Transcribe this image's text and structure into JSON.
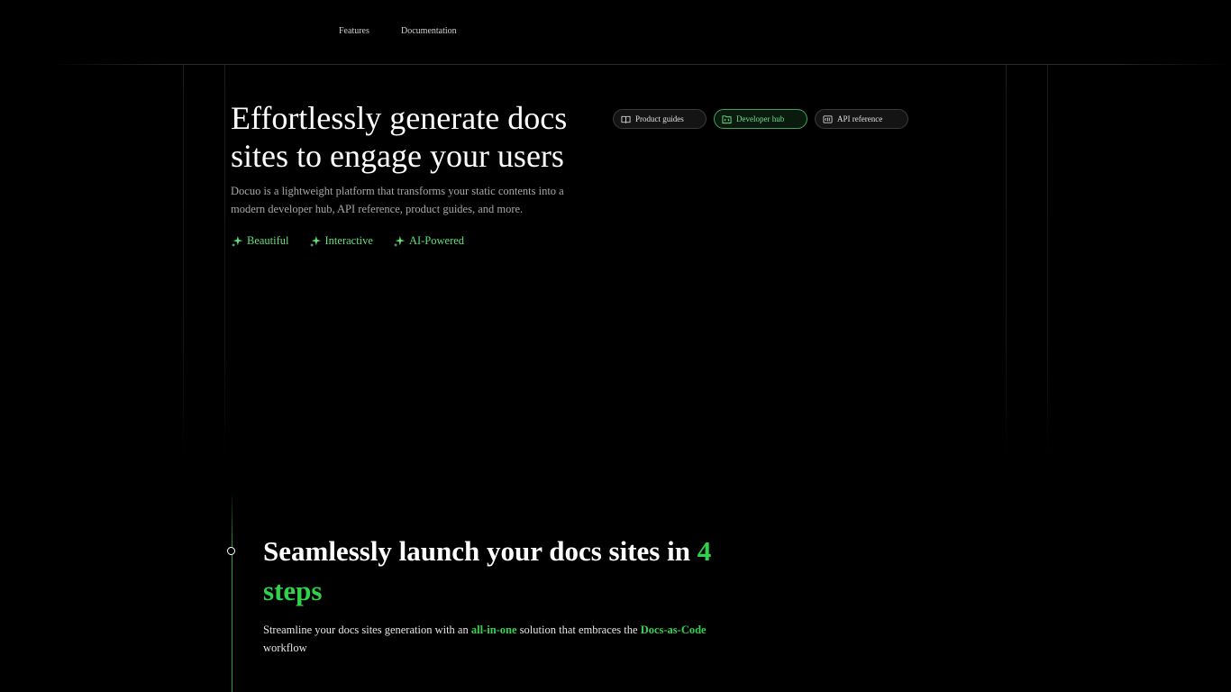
{
  "nav": {
    "links": [
      "Features",
      "Documentation"
    ]
  },
  "hero": {
    "title": "Effortlessly generate docs sites to engage your users",
    "subtitle": "Docuo is a lightweight platform that transforms your static contents into a modern developer hub, API reference, product guides, and more.",
    "features": [
      {
        "label": "Beautiful",
        "icon": "sparkle-icon"
      },
      {
        "label": "Interactive",
        "icon": "sparkle-icon"
      },
      {
        "label": "AI-Powered",
        "icon": "sparkle-icon"
      }
    ],
    "tabs": [
      {
        "label": "Product guides",
        "icon": "book-icon",
        "active": false
      },
      {
        "label": "Developer hub",
        "icon": "folder-code-icon",
        "active": true
      },
      {
        "label": "API reference",
        "icon": "api-icon",
        "active": false
      }
    ]
  },
  "steps_section": {
    "title_part1": "Seamlessly launch your docs sites in ",
    "title_accent": "4 steps",
    "sub_part1": "Streamline your docs sites generation with an ",
    "sub_accent1": "all-in-one",
    "sub_part2": " solution that embraces the ",
    "sub_accent2": "Docs-as-Code",
    "sub_part3": " workflow"
  },
  "colors": {
    "accent": "#2fd24a",
    "feature_green": "#5fe07a",
    "background": "#000000"
  }
}
